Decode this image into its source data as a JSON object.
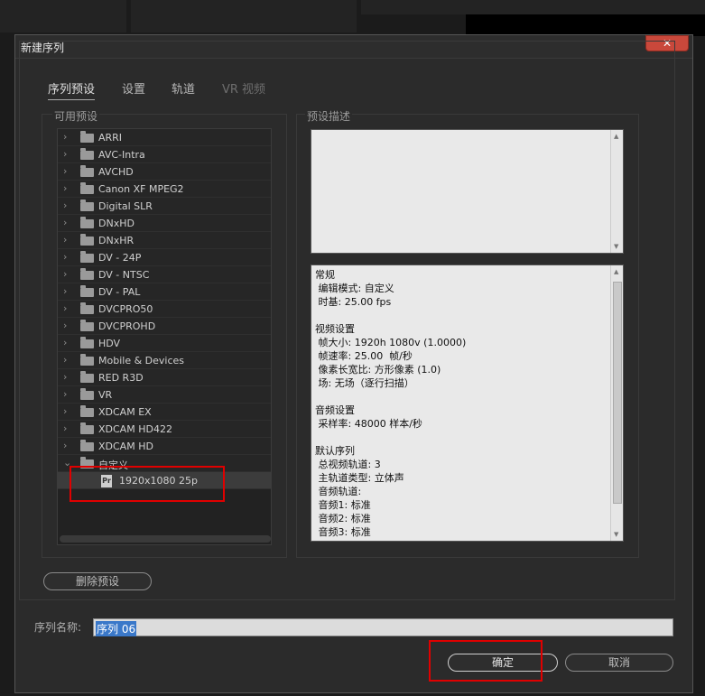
{
  "dialog": {
    "title": "新建序列",
    "close": "✕"
  },
  "tabs": [
    {
      "label": "序列预设"
    },
    {
      "label": "设置"
    },
    {
      "label": "轨道"
    },
    {
      "label": "VR 视频"
    }
  ],
  "left": {
    "heading": "可用预设",
    "folders": [
      "ARRI",
      "AVC-Intra",
      "AVCHD",
      "Canon XF MPEG2",
      "Digital SLR",
      "DNxHD",
      "DNxHR",
      "DV - 24P",
      "DV - NTSC",
      "DV - PAL",
      "DVCPRO50",
      "DVCPROHD",
      "HDV",
      "Mobile & Devices",
      "RED R3D",
      "VR",
      "XDCAM EX",
      "XDCAM HD422",
      "XDCAM HD"
    ],
    "custom_folder": "自定义",
    "custom_preset": "1920x1080 25p",
    "preset_icon_text": "Pr",
    "delete_button": "删除预设"
  },
  "right": {
    "heading": "预设描述",
    "info_lines": [
      "常规",
      " 编辑模式: 自定义",
      " 时基: 25.00 fps",
      "",
      "视频设置",
      " 帧大小: 1920h 1080v (1.0000)",
      " 帧速率: 25.00  帧/秒",
      " 像素长宽比: 方形像素 (1.0)",
      " 场: 无场（逐行扫描）",
      "",
      "音频设置",
      " 采样率: 48000 样本/秒",
      "",
      "默认序列",
      " 总视频轨道: 3",
      " 主轨道类型: 立体声",
      " 音频轨道:",
      " 音频1: 标准",
      " 音频2: 标准",
      " 音频3: 标准"
    ]
  },
  "footer": {
    "sequence_label": "序列名称:",
    "sequence_value": "序列 06",
    "ok": "确定",
    "cancel": "取消"
  },
  "colors": {
    "dialog_bg": "#2b2b2b",
    "highlight": "#e00000",
    "selection": "#3a78c9"
  }
}
